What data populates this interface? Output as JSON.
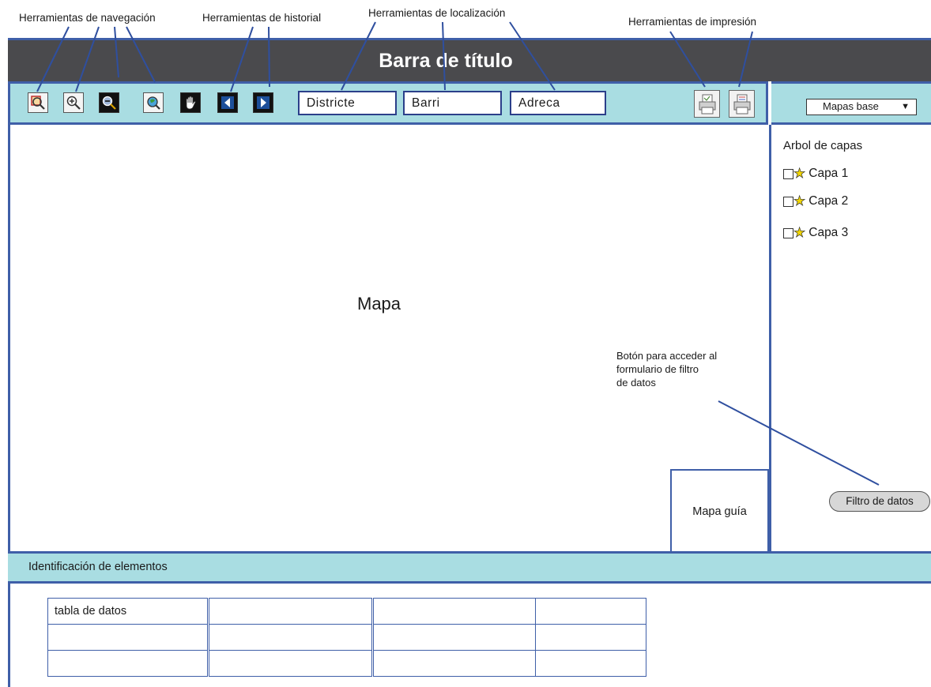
{
  "annotations": {
    "navegacion": "Herramientas de navegación",
    "historial": "Herramientas de historial",
    "localizacion": "Herramientas de localización",
    "impresion": "Herramientas de impresión"
  },
  "title_bar": {
    "title": "Barra de título"
  },
  "toolbar": {
    "tools": [
      {
        "icon": "zoom-window-icon"
      },
      {
        "icon": "zoom-in-icon"
      },
      {
        "icon": "zoom-out-icon"
      },
      {
        "icon": "full-extent-icon"
      },
      {
        "icon": "pan-hand-icon"
      },
      {
        "icon": "history-back-icon"
      },
      {
        "icon": "history-forward-icon"
      }
    ],
    "location_fields": [
      "Districte",
      "Barri",
      "Adreca"
    ],
    "print_tools": [
      {
        "icon": "print-preview-icon"
      },
      {
        "icon": "print-icon"
      }
    ]
  },
  "basemap_select": {
    "value": "Mapas base"
  },
  "layer_tree": {
    "title": "Arbol de capas",
    "layers": [
      "Capa 1",
      "Capa 2",
      "Capa 3"
    ]
  },
  "map": {
    "label": "Mapa",
    "guide_map_label": "Mapa guía"
  },
  "filter": {
    "note_lines": [
      "Botón para acceder al",
      "formulario de filtro",
      "de datos"
    ],
    "button_label": "Filtro de datos"
  },
  "identification": {
    "title": "Identificación de elementos",
    "table": {
      "rows": [
        [
          "tabla de datos",
          "",
          "",
          ""
        ],
        [
          "",
          "",
          "",
          ""
        ],
        [
          "",
          "",
          "",
          ""
        ]
      ]
    }
  },
  "colors": {
    "accent_border": "#3f5fa8",
    "toolbar_bg": "#a9dde2",
    "title_bg": "#4a4a4d"
  }
}
